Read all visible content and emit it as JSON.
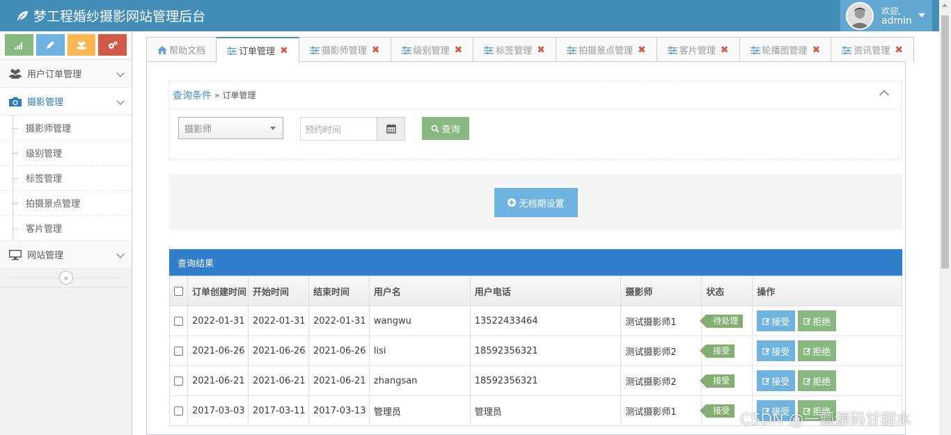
{
  "header": {
    "brand": "梦工程婚纱摄影网站管理后台",
    "welcome": "欢迎,",
    "username": "admin"
  },
  "sidebar": {
    "menus": [
      {
        "label": "用户订单管理",
        "icon": "users-icon"
      },
      {
        "label": "摄影管理",
        "icon": "camera-icon",
        "active": true
      },
      {
        "label": "网站管理",
        "icon": "desktop-icon"
      }
    ],
    "submenu": [
      "摄影师管理",
      "级别管理",
      "标签管理",
      "拍摄景点管理",
      "客片管理"
    ]
  },
  "tabs": [
    "帮助文档",
    "订单管理",
    "摄影师管理",
    "级别管理",
    "标签管理",
    "拍摄景点管理",
    "客片管理",
    "轮播图管理",
    "资讯管理"
  ],
  "query": {
    "title": "查询条件",
    "crumb_sep": "»",
    "crumb": "订单管理",
    "photographer_placeholder": "摄影师",
    "date_placeholder": "预约时间",
    "search_label": "查询"
  },
  "actions": {
    "no_schedule_label": "无档期设置"
  },
  "results": {
    "title": "查询结果",
    "columns": [
      "订单创建时间",
      "开始时间",
      "结束时间",
      "用户名",
      "用户电话",
      "摄影师",
      "状态",
      "操作"
    ],
    "accept_label": "接受",
    "reject_label": "拒绝",
    "rows": [
      {
        "created": "2022-01-31",
        "start": "2022-01-31",
        "end": "2022-01-31",
        "user": "wangwu",
        "phone": "13522433464",
        "photographer": "测试摄影师1",
        "status": "待处理"
      },
      {
        "created": "2021-06-26",
        "start": "2021-06-26",
        "end": "2021-06-26",
        "user": "lisi",
        "phone": "18592356321",
        "photographer": "测试摄影师2",
        "status": "接受"
      },
      {
        "created": "2021-06-21",
        "start": "2021-06-21",
        "end": "2021-06-21",
        "user": "zhangsan",
        "phone": "18592356321",
        "photographer": "测试摄影师2",
        "status": "接受"
      },
      {
        "created": "2017-03-03",
        "start": "2017-03-11",
        "end": "2017-03-13",
        "user": "管理员",
        "phone": "管理员",
        "photographer": "测试摄影师1",
        "status": "接受"
      }
    ]
  },
  "watermark": "CSDN @一瓢源码甘甜水",
  "colors": {
    "navbar": "#438eb9",
    "result_header": "#307ecc",
    "accept": "#6fb3e0",
    "reject": "#87b87f",
    "status": "#82af6f"
  }
}
